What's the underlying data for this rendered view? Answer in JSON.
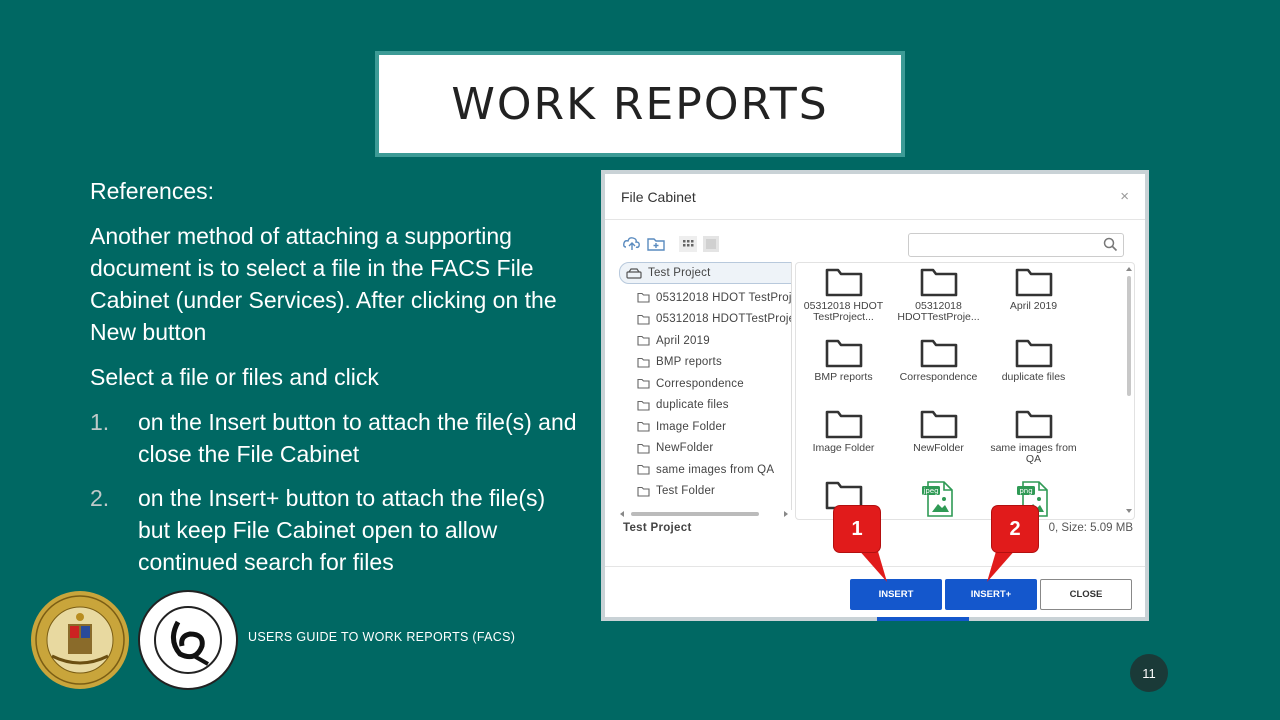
{
  "slide": {
    "title": "WORK REPORTS",
    "references_label": "References:",
    "paragraph": "Another method of attaching a supporting document is to select a file in the FACS File Cabinet (under Services).  After clicking on the New button",
    "select_line": "Select a file or files and click",
    "steps": [
      {
        "num": "1.",
        "text": "on the Insert button to attach the file(s) and close the File Cabinet"
      },
      {
        "num": "2.",
        "text": "on the Insert+ button to attach the file(s) but keep File Cabinet open to allow continued search for files"
      }
    ],
    "footer": "USERS GUIDE TO WORK REPORTS  (FACS)",
    "page_number": "11"
  },
  "dialog": {
    "title": "File Cabinet",
    "close_glyph": "×",
    "search_placeholder": "",
    "tree": {
      "root": "Test Project",
      "children": [
        "05312018 HDOT TestProje",
        "05312018 HDOTTestProje",
        "April 2019",
        "BMP reports",
        "Correspondence",
        "duplicate files",
        "Image Folder",
        "NewFolder",
        "same images from QA",
        "Test Folder"
      ]
    },
    "grid_items": [
      {
        "name": "05312018 HDOT TestProject...",
        "icon": "folder-icon"
      },
      {
        "name": "05312018 HDOTTestProje...",
        "icon": "folder-icon"
      },
      {
        "name": "April 2019",
        "icon": "folder-icon"
      },
      {
        "name": "BMP reports",
        "icon": "folder-icon"
      },
      {
        "name": "Correspondence",
        "icon": "folder-icon"
      },
      {
        "name": "duplicate files",
        "icon": "folder-icon"
      },
      {
        "name": "Image Folder",
        "icon": "folder-icon"
      },
      {
        "name": "NewFolder",
        "icon": "folder-icon"
      },
      {
        "name": "same images from QA",
        "icon": "folder-icon"
      },
      {
        "name": "",
        "icon": "folder-icon"
      },
      {
        "name": "",
        "icon": "jpeg-file-icon",
        "badge": "jpeg"
      },
      {
        "name": "",
        "icon": "png-file-icon",
        "badge": "png"
      }
    ],
    "status_left": "Test Project",
    "status_right": "0, Size: 5.09 MB",
    "buttons": {
      "insert": "INSERT",
      "insert_plus": "INSERT+",
      "close": "CLOSE"
    },
    "callouts": [
      "1",
      "2"
    ]
  },
  "colors": {
    "background": "#006863",
    "primary_button": "#1457cc",
    "callout": "#e11b1b"
  }
}
